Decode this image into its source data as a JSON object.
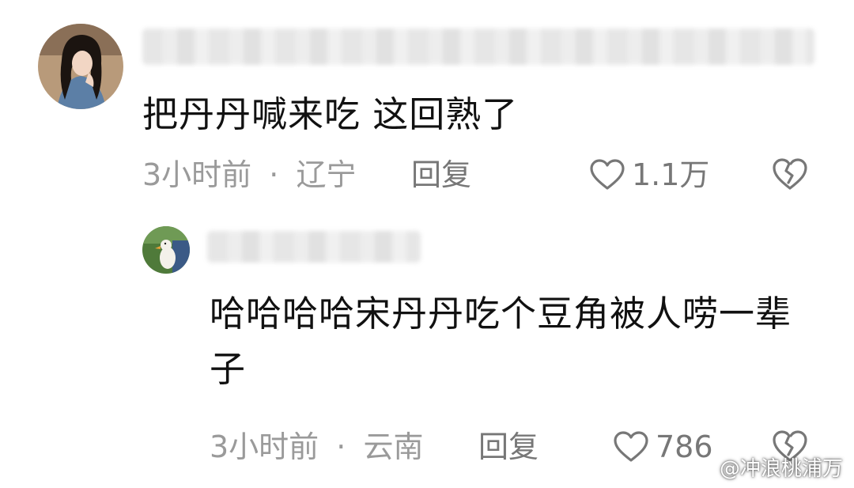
{
  "comments": [
    {
      "text": "把丹丹喊来吃 这回熟了",
      "time": "3小时前",
      "separator": "·",
      "location": "辽宁",
      "reply_label": "回复",
      "likes": "1.1万"
    },
    {
      "text": "哈哈哈哈宋丹丹吃个豆角被人唠一辈子",
      "time": "3小时前",
      "separator": "·",
      "location": "云南",
      "reply_label": "回复",
      "likes": "786"
    }
  ],
  "watermark": {
    "text": "@冲浪桃浦万"
  },
  "icons": {
    "like": "heart-outline-icon",
    "dislike": "broken-heart-icon",
    "watermark_logo": "weibo-logo-icon"
  },
  "colors": {
    "text": "#111111",
    "meta": "#9a9a9a",
    "action": "#777777",
    "background": "#ffffff"
  }
}
